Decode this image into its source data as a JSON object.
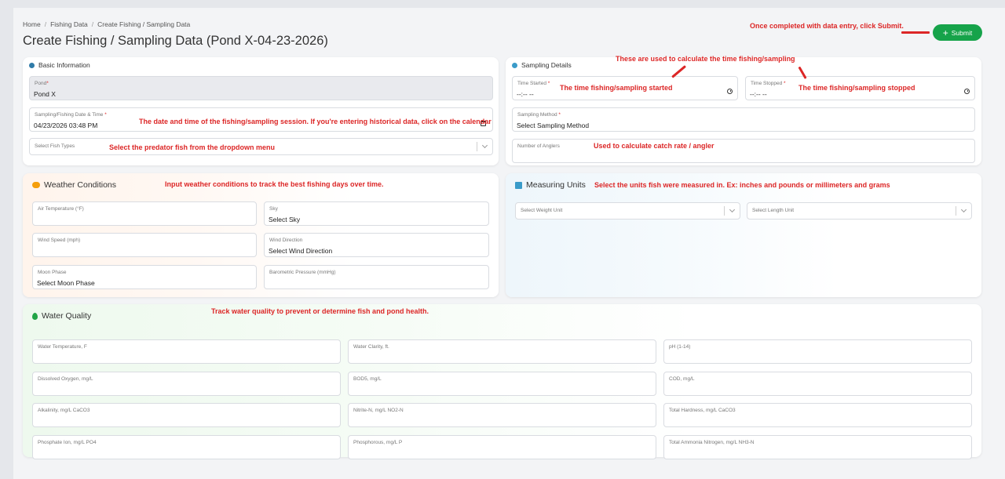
{
  "breadcrumb": {
    "home": "Home",
    "fishing_data": "Fishing Data",
    "current": "Create Fishing / Sampling Data"
  },
  "page": {
    "title": "Create Fishing / Sampling Data (Pond X-04-23-2026)",
    "submit_label": "Submit",
    "submit_color": "#16a34a"
  },
  "basic": {
    "title": "Basic Information",
    "pond_label": "Pond",
    "pond_value": "Pond X",
    "datetime_label": "Sampling/Fishing Date & Time",
    "datetime_value": "04/23/2026 03:48 PM",
    "fish_types_placeholder": "Select Fish Types"
  },
  "sampling": {
    "title": "Sampling Details",
    "time_started_label": "Time Started",
    "time_started_value": "--:-- --",
    "time_stopped_label": "Time Stopped",
    "time_stopped_value": "--:-- --",
    "method_label": "Sampling Method",
    "method_value": "Select Sampling Method",
    "anglers_label": "Number of Anglers"
  },
  "weather": {
    "title": "Weather Conditions",
    "air_temp_label": "Air Temperature (°F)",
    "sky_label": "Sky",
    "sky_value": "Select Sky",
    "wind_speed_label": "Wind Speed (mph)",
    "wind_dir_label": "Wind Direction",
    "wind_dir_value": "Select Wind Direction",
    "moon_label": "Moon Phase",
    "moon_value": "Select Moon Phase",
    "pressure_label": "Barometric Pressure (mmHg)"
  },
  "units": {
    "title": "Measuring Units",
    "weight_placeholder": "Select Weight Unit",
    "length_placeholder": "Select Length Unit"
  },
  "water": {
    "title": "Water Quality",
    "fields": [
      "Water Temperature, F",
      "Water Clarity, ft.",
      "pH (1-14)",
      "Dissolved Oxygen, mg/L",
      "BOD5, mg/L",
      "COD, mg/L",
      "Alkalinity, mg/L CaCO3",
      "Nitrite-N, mg/L NO2-N",
      "Total Hardness, mg/L CaCO3",
      "Phosphate Ion, mg/L PO4",
      "Phosphorous, mg/L P",
      "Total Ammonia Nitrogen, mg/L NH3-N"
    ]
  },
  "notes": {
    "submit": "Once completed with data entry, click Submit.",
    "time_calc": "These are used to calculate the time fishing/sampling",
    "time_started": "The time fishing/sampling started",
    "time_stopped": "The time fishing/sampling stopped",
    "datetime": "The date and time of the fishing/sampling session. If you're entering historical data, click on the calendar",
    "fish": "Select the predator fish from the dropdown menu",
    "anglers": "Used to calculate catch rate / angler",
    "weather": "Input weather conditions to track the best fishing days over time.",
    "units": "Select the units fish were measured in. Ex: inches and pounds or millimeters and grams",
    "water": "Track water quality to prevent or determine fish and pond health."
  },
  "colors": {
    "annotation": "#dc2626",
    "info_icon": "#2f7ba8",
    "weather_icon": "#f59e0b",
    "units_icon": "#3a9bc9",
    "water_icon": "#22a447"
  }
}
